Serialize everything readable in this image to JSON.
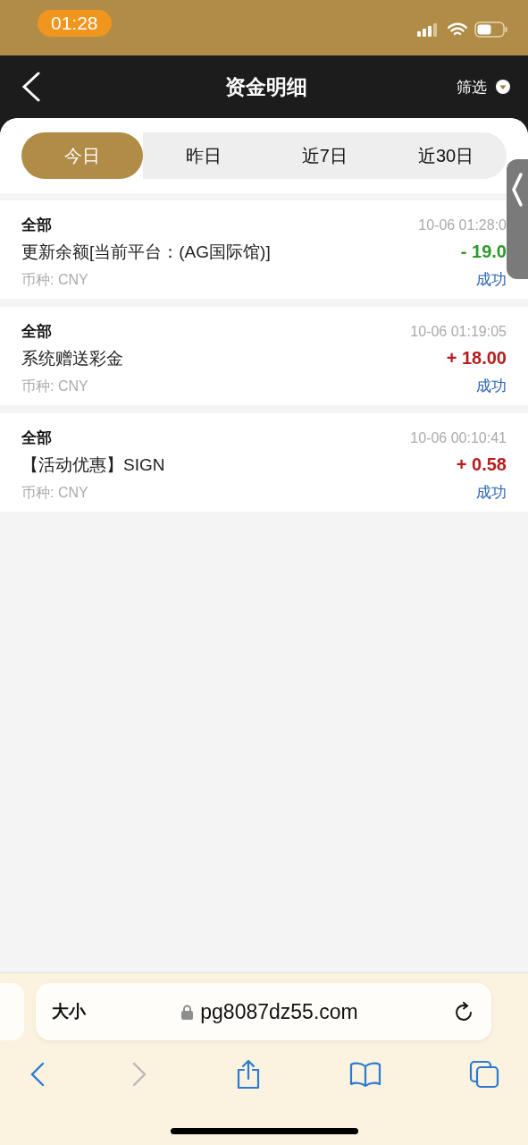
{
  "status_bar": {
    "time": "01:28"
  },
  "nav": {
    "title": "资金明细",
    "filter": "筛选"
  },
  "tabs": [
    {
      "label": "今日",
      "selected": true
    },
    {
      "label": "昨日",
      "selected": false
    },
    {
      "label": "近7日",
      "selected": false
    },
    {
      "label": "近30日",
      "selected": false
    }
  ],
  "records": [
    {
      "type": "全部",
      "time": "10-06 01:28:0",
      "description": "更新余额[当前平台：(AG国际馆)]",
      "amount": "- 19.0",
      "kind": "debit",
      "currency": "币种: CNY",
      "status": "成功"
    },
    {
      "type": "全部",
      "time": "10-06 01:19:05",
      "description": "系统赠送彩金",
      "amount": "+ 18.00",
      "kind": "credit",
      "currency": "币种: CNY",
      "status": "成功"
    },
    {
      "type": "全部",
      "time": "10-06 00:10:41",
      "description": "【活动优惠】SIGN",
      "amount": "+ 0.58",
      "kind": "credit",
      "currency": "币种: CNY",
      "status": "成功"
    }
  ],
  "browser": {
    "text_size": "大小",
    "url": "pg8087dz55.com"
  }
}
